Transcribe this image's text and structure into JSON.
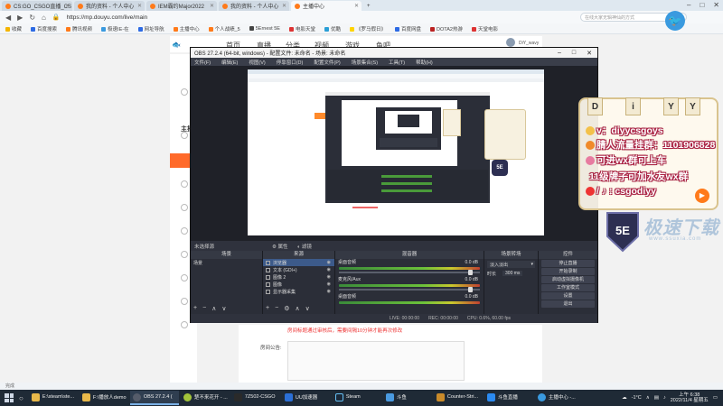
{
  "browser": {
    "tabs": [
      {
        "title": "CS:GO_CSGO直播_CS",
        "color": "#ff7a1a"
      },
      {
        "title": "我的资料 - 个人中心",
        "color": "#ff7a1a"
      },
      {
        "title": "IEM霸约Major2022",
        "color": "#ff7a1a"
      },
      {
        "title": "我的资料 - 个人中心",
        "color": "#ff7a1a"
      },
      {
        "title": "主播中心",
        "color": "#ff7a1a",
        "active": true
      }
    ],
    "url": "https://mp.douyu.com/live/main",
    "search_placeholder": "在线大家无辑神仙的方式",
    "bookmarks": [
      "收藏",
      "百度搜索",
      "腾讯视频",
      "极速IE-在",
      "网址导航",
      "主播中心",
      "个人战绩_5",
      "5Ernest 5E",
      "电影天堂",
      "优酷",
      "《罗马假日》",
      "百度网盘",
      "DOTA2热游",
      "天堂电影"
    ]
  },
  "douyu_page": {
    "nav": [
      "首页",
      "直播",
      "分类",
      "视频",
      "游戏",
      "鱼吧"
    ],
    "left_title": "主播",
    "red_notice": "房间标题通过审核后，需要间隔10分钟才能再次修改",
    "announcement_label": "房间公告:",
    "username": "DiY_wavy"
  },
  "obs": {
    "title": "OBS 27.2.4 (64-bit, windows) - 配置文件: 未命名 - 场景: 未命名",
    "menu": [
      "文件(F)",
      "编辑(E)",
      "视图(V)",
      "停靠窗口(D)",
      "配置文件(P)",
      "场景集合(S)",
      "工具(T)",
      "帮助(H)"
    ],
    "source_toolbar": {
      "label": "未选择源",
      "props": "属性",
      "filters": "滤镜"
    },
    "docks": {
      "scenes": {
        "title": "场景",
        "items": [
          "场景"
        ]
      },
      "sources": {
        "title": "来源",
        "items": [
          "浏览器",
          "文本 (GDI+)",
          "图像 2",
          "图像",
          "显示器采集"
        ]
      },
      "mixer": {
        "title": "混音器",
        "channels": [
          {
            "name": "桌面音频",
            "db": "0.0 dB"
          },
          {
            "name": "麦克风/Aux",
            "db": "0.0 dB"
          },
          {
            "name": "桌面音频",
            "db": "0.0 dB"
          }
        ]
      },
      "transitions": {
        "title": "场景转场",
        "type": "淡入淡出",
        "duration_label": "时长",
        "duration": "300 ms"
      },
      "controls": {
        "title": "控件",
        "buttons": [
          "停止直播",
          "开始录制",
          "启动虚拟摄像机",
          "工作室模式",
          "设置",
          "退出"
        ]
      }
    },
    "status": [
      "LIVE: 00:00:00",
      "REC: 00:00:00",
      "CPU: 0.6%, 60.00 fps"
    ]
  },
  "overlay": {
    "letters": [
      "D",
      "i",
      "Y",
      "Y"
    ],
    "lines": [
      {
        "icon": "key",
        "color": "#f3c14a",
        "text": "v：diyycsgoys"
      },
      {
        "icon": "megaphone",
        "color": "#f08a2a",
        "text": "腈人流量挂群：1101906828"
      },
      {
        "icon": "wechat",
        "color": "#e77ba0",
        "text": "可进wx群可上车"
      },
      {
        "icon": "none",
        "color": "#000",
        "text": "11级牌子可加水友wx群"
      },
      {
        "icon": "tiktok",
        "color": "#e33",
        "text": "/ ♪ : csgodiyy"
      }
    ],
    "logo": "5E",
    "watermark": "极速下载",
    "watermark_sub": "www.ssuxia.com"
  },
  "status_bar": "完成",
  "taskbar": {
    "items": [
      {
        "label": "E:\\steam\\ste...",
        "color": "#e8b84a"
      },
      {
        "label": "F:\\播放人demo",
        "color": "#e8b84a"
      },
      {
        "label": "OBS 27.2.4 (",
        "color": "#555c6a",
        "active": true
      },
      {
        "label": "楚不来花开 - ...",
        "color": "#a3c43a"
      },
      {
        "label": "7Z502-CSGO",
        "color": "#2a2a2a"
      },
      {
        "label": "UU加速器",
        "color": "#2b6fd6"
      },
      {
        "label": "Steam",
        "color": "#1b2838"
      },
      {
        "label": "斗鱼",
        "color": "#4a9ae0"
      },
      {
        "label": "Counter-Stri...",
        "color": "#c98a2a"
      },
      {
        "label": "斗鱼直播",
        "color": "#2b8af0"
      },
      {
        "label": "主播中心 -...",
        "color": "#3a9adf"
      }
    ],
    "temperature": "-1°C",
    "time": "上午 6:38",
    "date": "2022/11/4 星期五"
  }
}
